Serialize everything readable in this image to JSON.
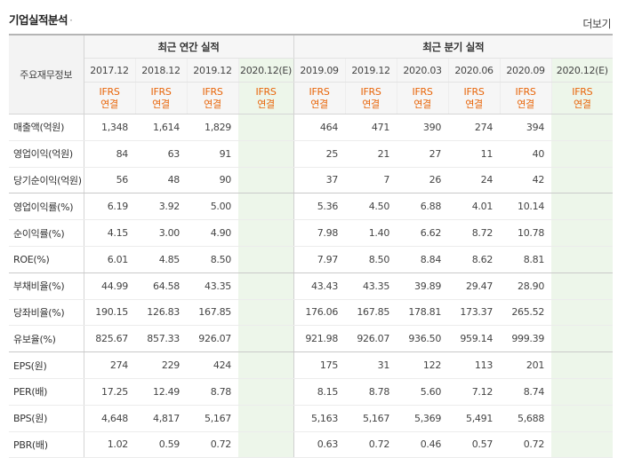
{
  "header": {
    "title": "기업실적분석",
    "more_label": "더보기"
  },
  "table": {
    "row_header_label": "주요재무정보",
    "groups": {
      "annual": "최근 연간 실적",
      "quarterly": "최근 분기 실적"
    },
    "ifrs_top": "IFRS",
    "ifrs_bottom": "연결",
    "periods": [
      "2017.12",
      "2018.12",
      "2019.12",
      "2020.12(E)",
      "2019.09",
      "2019.12",
      "2020.03",
      "2020.06",
      "2020.09",
      "2020.12(E)"
    ],
    "rows": [
      {
        "label": "매출액(억원)",
        "values": [
          "1,348",
          "1,614",
          "1,829",
          "",
          "464",
          "471",
          "390",
          "274",
          "394",
          ""
        ]
      },
      {
        "label": "영업이익(억원)",
        "values": [
          "84",
          "63",
          "91",
          "",
          "25",
          "21",
          "27",
          "11",
          "40",
          ""
        ]
      },
      {
        "label": "당기순이익(억원)",
        "values": [
          "56",
          "48",
          "90",
          "",
          "37",
          "7",
          "26",
          "24",
          "42",
          ""
        ]
      },
      {
        "label": "영업이익률(%)",
        "values": [
          "6.19",
          "3.92",
          "5.00",
          "",
          "5.36",
          "4.50",
          "6.88",
          "4.01",
          "10.14",
          ""
        ]
      },
      {
        "label": "순이익률(%)",
        "values": [
          "4.15",
          "3.00",
          "4.90",
          "",
          "7.98",
          "1.40",
          "6.62",
          "8.72",
          "10.78",
          ""
        ]
      },
      {
        "label": "ROE(%)",
        "values": [
          "6.01",
          "4.85",
          "8.50",
          "",
          "7.97",
          "8.50",
          "8.84",
          "8.62",
          "8.81",
          ""
        ]
      },
      {
        "label": "부채비율(%)",
        "values": [
          "44.99",
          "64.58",
          "43.35",
          "",
          "43.43",
          "43.35",
          "39.89",
          "29.47",
          "28.90",
          ""
        ]
      },
      {
        "label": "당좌비율(%)",
        "values": [
          "190.15",
          "126.83",
          "167.85",
          "",
          "176.06",
          "167.85",
          "178.81",
          "173.37",
          "265.52",
          ""
        ]
      },
      {
        "label": "유보율(%)",
        "values": [
          "825.67",
          "857.33",
          "926.07",
          "",
          "921.98",
          "926.07",
          "936.50",
          "959.14",
          "999.39",
          ""
        ]
      },
      {
        "label": "EPS(원)",
        "values": [
          "274",
          "229",
          "424",
          "",
          "175",
          "31",
          "122",
          "113",
          "201",
          ""
        ]
      },
      {
        "label": "PER(배)",
        "values": [
          "17.25",
          "12.49",
          "8.78",
          "",
          "8.15",
          "8.78",
          "5.60",
          "7.12",
          "8.74",
          ""
        ]
      },
      {
        "label": "BPS(원)",
        "values": [
          "4,648",
          "4,817",
          "5,167",
          "",
          "5,163",
          "5,167",
          "5,369",
          "5,491",
          "5,688",
          ""
        ]
      },
      {
        "label": "PBR(배)",
        "values": [
          "1.02",
          "0.59",
          "0.72",
          "",
          "0.63",
          "0.72",
          "0.46",
          "0.57",
          "0.72",
          ""
        ]
      }
    ],
    "estimate_color": "#edf6ea",
    "ifrs_color": "#e8650a"
  }
}
